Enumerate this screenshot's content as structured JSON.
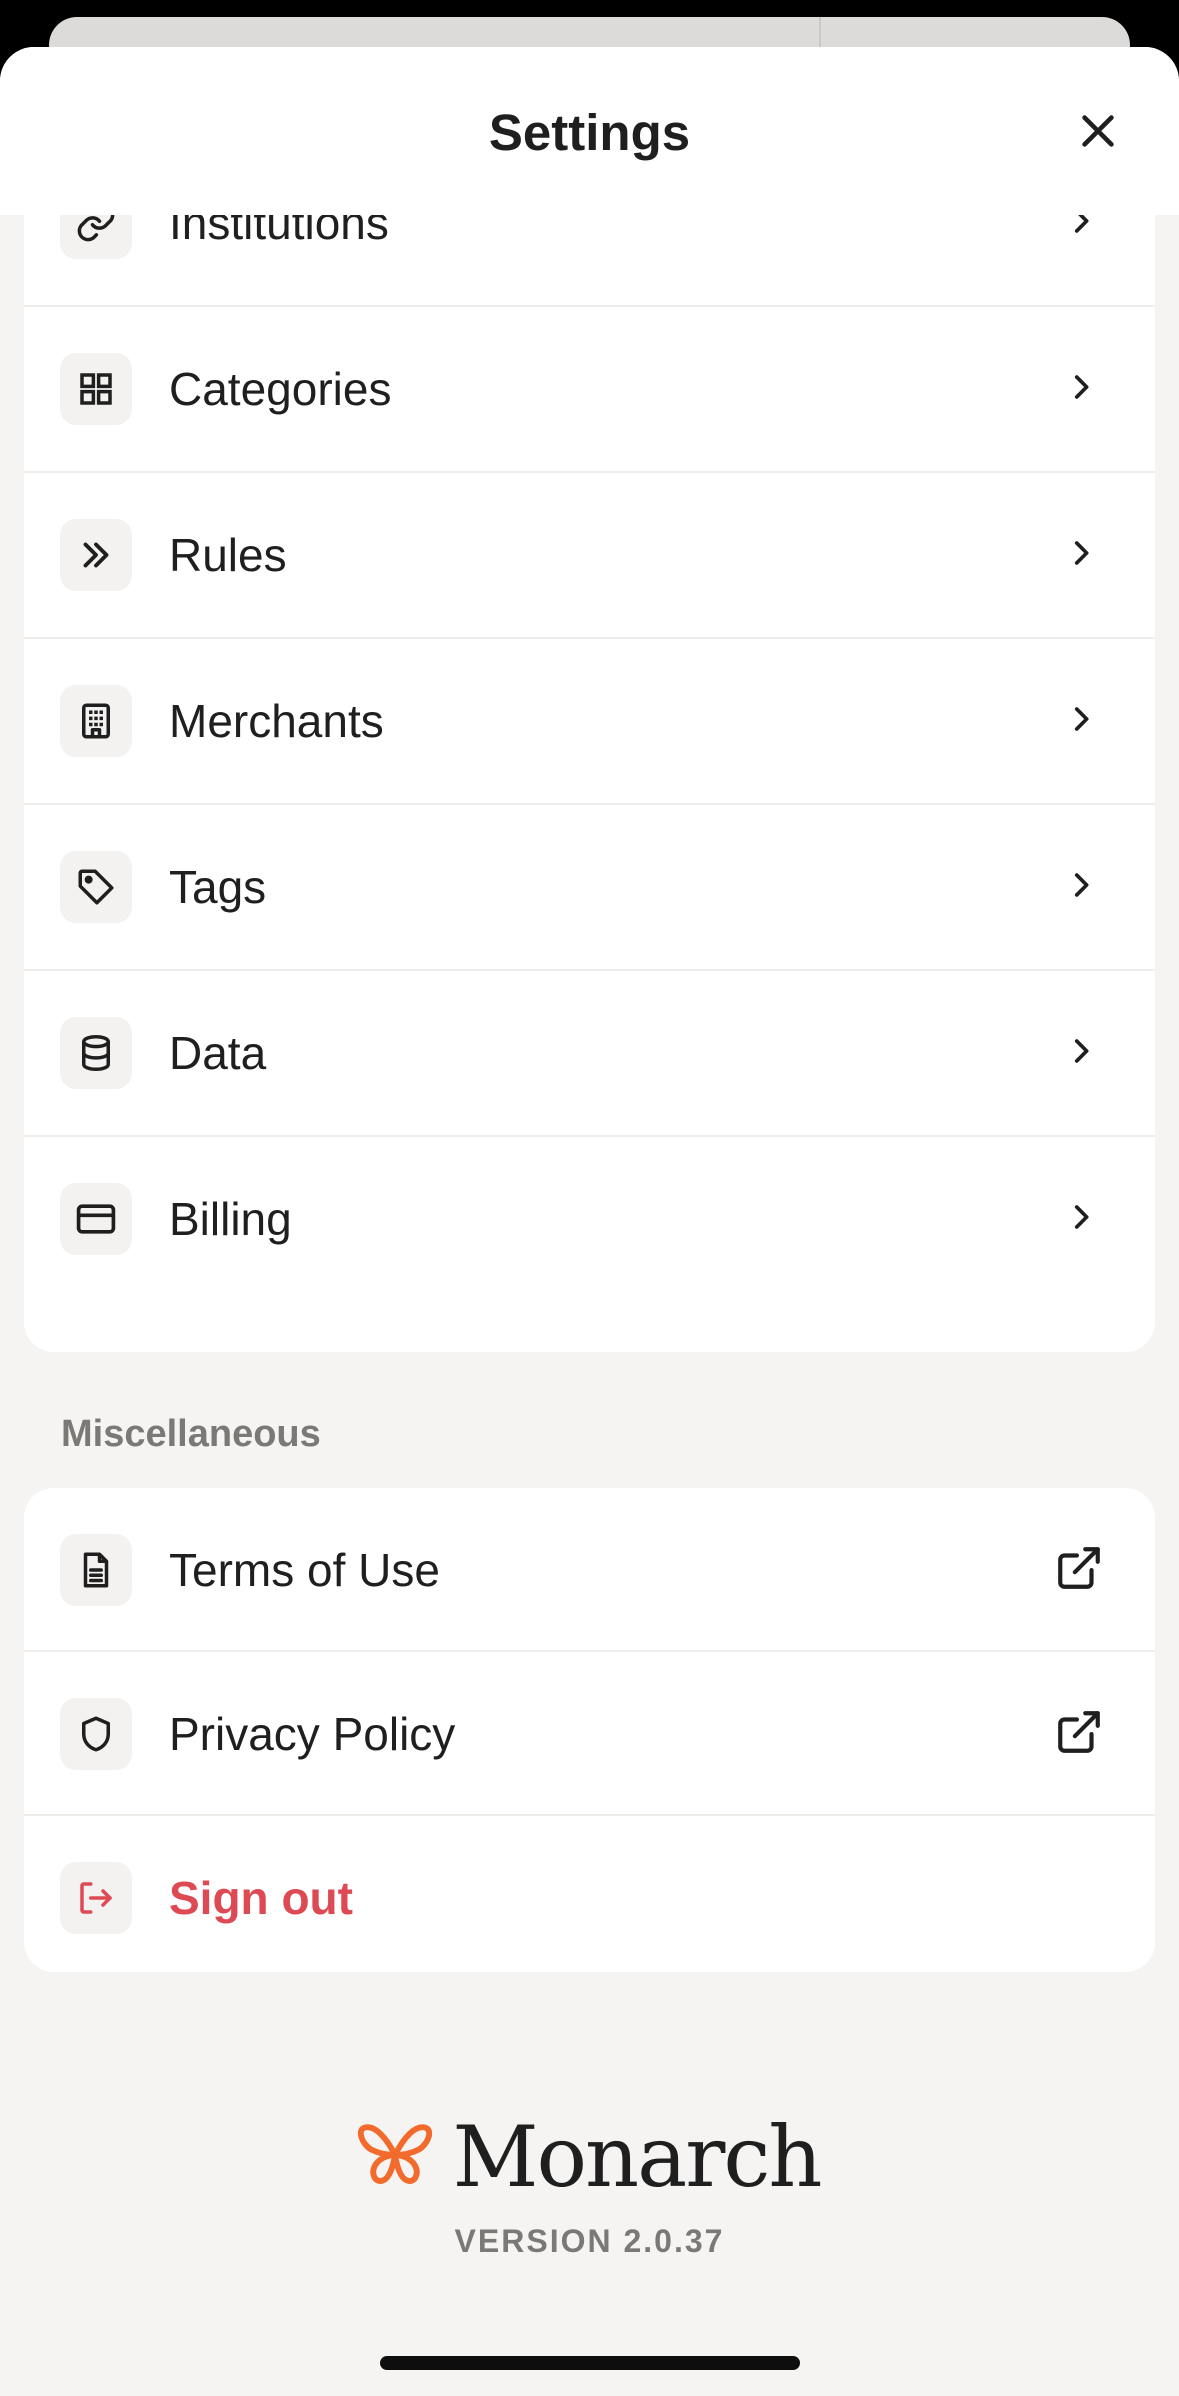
{
  "header": {
    "title": "Settings",
    "close_icon": "close-icon"
  },
  "settings_items": [
    {
      "label": "Institutions",
      "icon": "link-icon"
    },
    {
      "label": "Categories",
      "icon": "grid-icon"
    },
    {
      "label": "Rules",
      "icon": "double-chevron-icon"
    },
    {
      "label": "Merchants",
      "icon": "building-icon"
    },
    {
      "label": "Tags",
      "icon": "tag-icon"
    },
    {
      "label": "Data",
      "icon": "database-icon"
    },
    {
      "label": "Billing",
      "icon": "credit-card-icon"
    }
  ],
  "misc": {
    "section_label": "Miscellaneous",
    "items": [
      {
        "label": "Terms of Use",
        "icon": "document-icon",
        "trailing_icon": "external-link-icon"
      },
      {
        "label": "Privacy Policy",
        "icon": "shield-icon",
        "trailing_icon": "external-link-icon"
      },
      {
        "label": "Sign out",
        "icon": "sign-out-icon"
      }
    ]
  },
  "brand": {
    "name": "Monarch",
    "version": "VERSION 2.0.37",
    "accent": "#f26b2c"
  },
  "colors": {
    "danger": "#de4a54",
    "background": "#f5f4f2"
  }
}
